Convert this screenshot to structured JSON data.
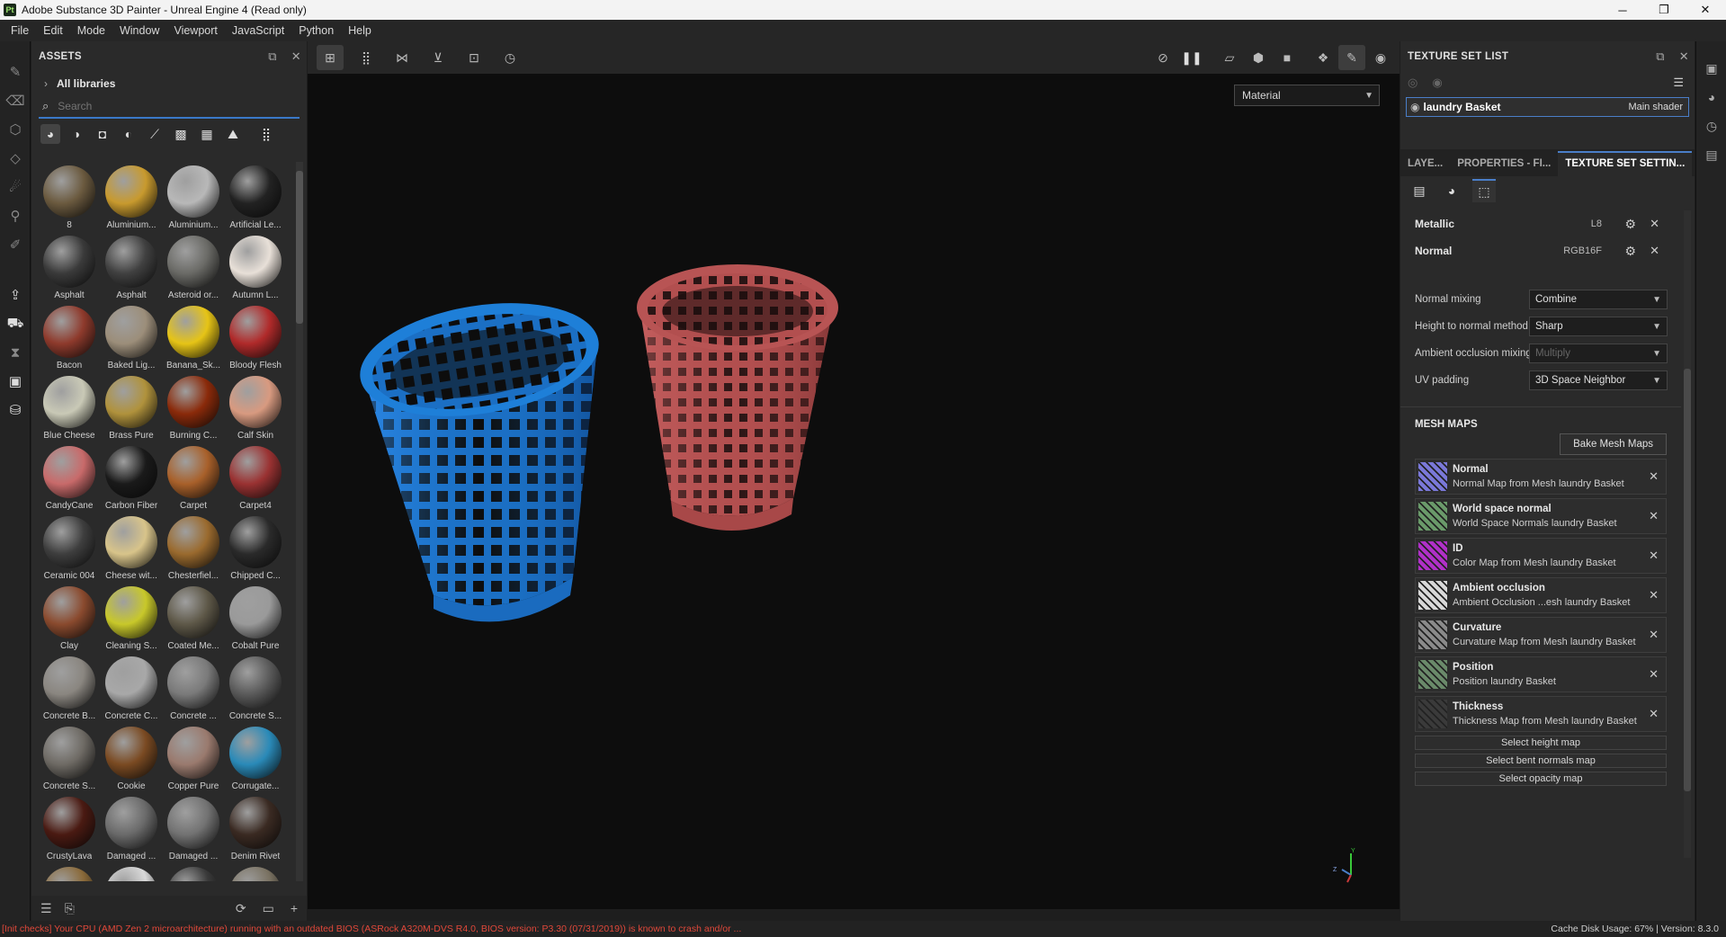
{
  "window": {
    "title": "Adobe Substance 3D Painter - Unreal Engine 4 (Read only)",
    "app_badge": "Pt",
    "controls": [
      "─",
      "❐",
      "✕"
    ]
  },
  "menu": [
    "File",
    "Edit",
    "Mode",
    "Window",
    "Viewport",
    "JavaScript",
    "Python",
    "Help"
  ],
  "assets": {
    "title": "ASSETS",
    "library": "All libraries",
    "search_placeholder": "Search",
    "items": [
      {
        "label": "8",
        "color": "#6b5a3f"
      },
      {
        "label": "Aluminium...",
        "color": "#c89a2e"
      },
      {
        "label": "Aluminium...",
        "color": "#b8b8b8"
      },
      {
        "label": "Artificial Le...",
        "color": "#222222"
      },
      {
        "label": "Asphalt",
        "color": "#3a3a3a"
      },
      {
        "label": "Asphalt",
        "color": "#404040"
      },
      {
        "label": "Asteroid or...",
        "color": "#6a6a66"
      },
      {
        "label": "Autumn L...",
        "color": "#e8e0d8"
      },
      {
        "label": "Bacon",
        "color": "#8e3a2c"
      },
      {
        "label": "Baked Lig...",
        "color": "#9c8e7a"
      },
      {
        "label": "Banana_Sk...",
        "color": "#e6c416"
      },
      {
        "label": "Bloody Flesh",
        "color": "#b02a2a"
      },
      {
        "label": "Blue Cheese",
        "color": "#c9c9b6"
      },
      {
        "label": "Brass Pure",
        "color": "#b0923c"
      },
      {
        "label": "Burning C...",
        "color": "#8a2a0a"
      },
      {
        "label": "Calf Skin",
        "color": "#d89a80"
      },
      {
        "label": "CandyCane",
        "color": "#c86a6a"
      },
      {
        "label": "Carbon Fiber",
        "color": "#1a1a1a"
      },
      {
        "label": "Carpet",
        "color": "#a8602a"
      },
      {
        "label": "Carpet4",
        "color": "#9a3232"
      },
      {
        "label": "Ceramic 004",
        "color": "#3e3e3e"
      },
      {
        "label": "Cheese wit...",
        "color": "#d8c48a"
      },
      {
        "label": "Chesterfiel...",
        "color": "#9a6a2e"
      },
      {
        "label": "Chipped C...",
        "color": "#2a2a2a"
      },
      {
        "label": "Clay",
        "color": "#8a4a2e"
      },
      {
        "label": "Cleaning S...",
        "color": "#c8c82a"
      },
      {
        "label": "Coated Me...",
        "color": "#5e5848"
      },
      {
        "label": "Cobalt Pure",
        "color": "#9a9a9a"
      },
      {
        "label": "Concrete B...",
        "color": "#8a8680"
      },
      {
        "label": "Concrete C...",
        "color": "#a8a8a8"
      },
      {
        "label": "Concrete ...",
        "color": "#7a7a7a"
      },
      {
        "label": "Concrete S...",
        "color": "#5a5a5a"
      },
      {
        "label": "Concrete S...",
        "color": "#6e6a64"
      },
      {
        "label": "Cookie",
        "color": "#7a4a22"
      },
      {
        "label": "Copper Pure",
        "color": "#9a7a6e"
      },
      {
        "label": "Corrugate...",
        "color": "#2a8ab8"
      },
      {
        "label": "CrustyLava",
        "color": "#4a1a12"
      },
      {
        "label": "Damaged ...",
        "color": "#6a6a6a"
      },
      {
        "label": "Damaged ...",
        "color": "#727272"
      },
      {
        "label": "Denim Rivet",
        "color": "#3a2a22"
      },
      {
        "label": "",
        "color": "#8a6a3a"
      },
      {
        "label": "",
        "color": "#d8d8d8"
      },
      {
        "label": "",
        "color": "#3a3a3a"
      },
      {
        "label": "",
        "color": "#7a7262"
      }
    ]
  },
  "viewport": {
    "mode": "Material"
  },
  "texture_set_list": {
    "title": "TEXTURE SET LIST",
    "set_name": "laundry Basket",
    "shader": "Main shader"
  },
  "tabs": {
    "layers": "LAYE...",
    "properties": "PROPERTIES - FI...",
    "texture_settings": "TEXTURE SET SETTIN..."
  },
  "channels": [
    {
      "name": "Metallic",
      "format": "L8"
    },
    {
      "name": "Normal",
      "format": "RGB16F"
    }
  ],
  "props": {
    "normal_mixing": {
      "label": "Normal mixing",
      "value": "Combine"
    },
    "height_to_normal": {
      "label": "Height to normal method",
      "value": "Sharp"
    },
    "ao_mixing": {
      "label": "Ambient occlusion mixing",
      "value": "Multiply"
    },
    "uv_padding": {
      "label": "UV padding",
      "value": "3D Space Neighbor"
    }
  },
  "mesh_maps": {
    "title": "MESH MAPS",
    "bake_label": "Bake Mesh Maps",
    "items": [
      {
        "title": "Normal",
        "subtitle": "Normal Map from Mesh laundry Basket",
        "color": "#7a78d8"
      },
      {
        "title": "World space normal",
        "subtitle": "World Space Normals laundry Basket",
        "color": "#6a9a6a"
      },
      {
        "title": "ID",
        "subtitle": "Color Map from Mesh laundry Basket",
        "color": "#b030c8"
      },
      {
        "title": "Ambient occlusion",
        "subtitle": "Ambient Occlusion ...esh laundry Basket",
        "color": "#d8d8d8"
      },
      {
        "title": "Curvature",
        "subtitle": "Curvature Map from Mesh laundry Basket",
        "color": "#8a8a8a"
      },
      {
        "title": "Position",
        "subtitle": "Position laundry Basket",
        "color": "#6a8a6a"
      },
      {
        "title": "Thickness",
        "subtitle": "Thickness Map from Mesh laundry Basket",
        "color": "#3a3a3a"
      }
    ],
    "select_height": "Select height map",
    "select_bent": "Select bent normals map",
    "select_opacity": "Select opacity map"
  },
  "status": {
    "warning": "[Init checks] Your CPU (AMD Zen 2 microarchitecture) running with an outdated BIOS (ASRock A320M-DVS R4.0, BIOS version: P3.30 (07/31/2019)) is known to crash and/or ...",
    "right": "Cache Disk Usage:   67% | Version: 8.3.0"
  },
  "colors": {
    "accent": "#4a7ec8",
    "warning": "#e0483a",
    "blue_basket": "#1e7fd8",
    "red_basket": "#b85454"
  }
}
